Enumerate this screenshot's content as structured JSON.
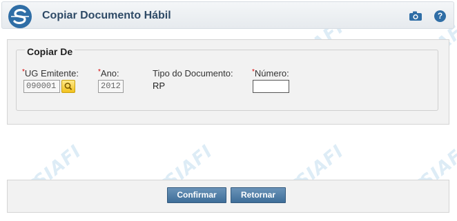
{
  "header": {
    "title": "Copiar Documento Hábil",
    "camera_icon": "camera-icon",
    "help_icon": "?"
  },
  "section": {
    "legend": "Copiar De",
    "fields": {
      "ug_emitente": {
        "label": "UG Emitente:",
        "required_mark": "*",
        "value": "090001"
      },
      "ano": {
        "label": "Ano:",
        "required_mark": "*",
        "value": "2012"
      },
      "tipo_documento": {
        "label": "Tipo do Documento:",
        "value": "RP"
      },
      "numero": {
        "label": "Número:",
        "required_mark": "*",
        "value": ""
      }
    }
  },
  "footer": {
    "confirm_label": "Confirmar",
    "return_label": "Retornar"
  },
  "watermark": {
    "text": "SIAFI"
  },
  "colors": {
    "accent": "#2f6ea6",
    "button": "#4f7ea8",
    "required": "#d40000",
    "search": "#f2c21e"
  }
}
